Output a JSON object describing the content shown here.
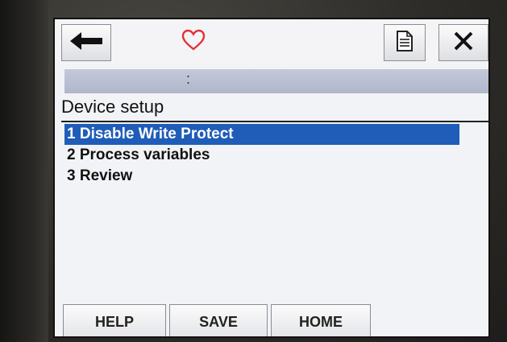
{
  "header": {
    "back_icon": "left-arrow-icon",
    "favorite_icon": "heart-icon",
    "favorite_color": "#e0323a",
    "document_icon": "document-icon",
    "close_icon": "close-icon",
    "status_text": ":"
  },
  "page": {
    "title": "Device setup"
  },
  "menu": {
    "items": [
      {
        "label": "1 Disable Write Protect",
        "selected": true
      },
      {
        "label": "2 Process variables",
        "selected": false
      },
      {
        "label": "3 Review",
        "selected": false
      }
    ],
    "selection_color": "#1f5db8"
  },
  "softkeys": {
    "help": "HELP",
    "save": "SAVE",
    "home": "HOME"
  }
}
